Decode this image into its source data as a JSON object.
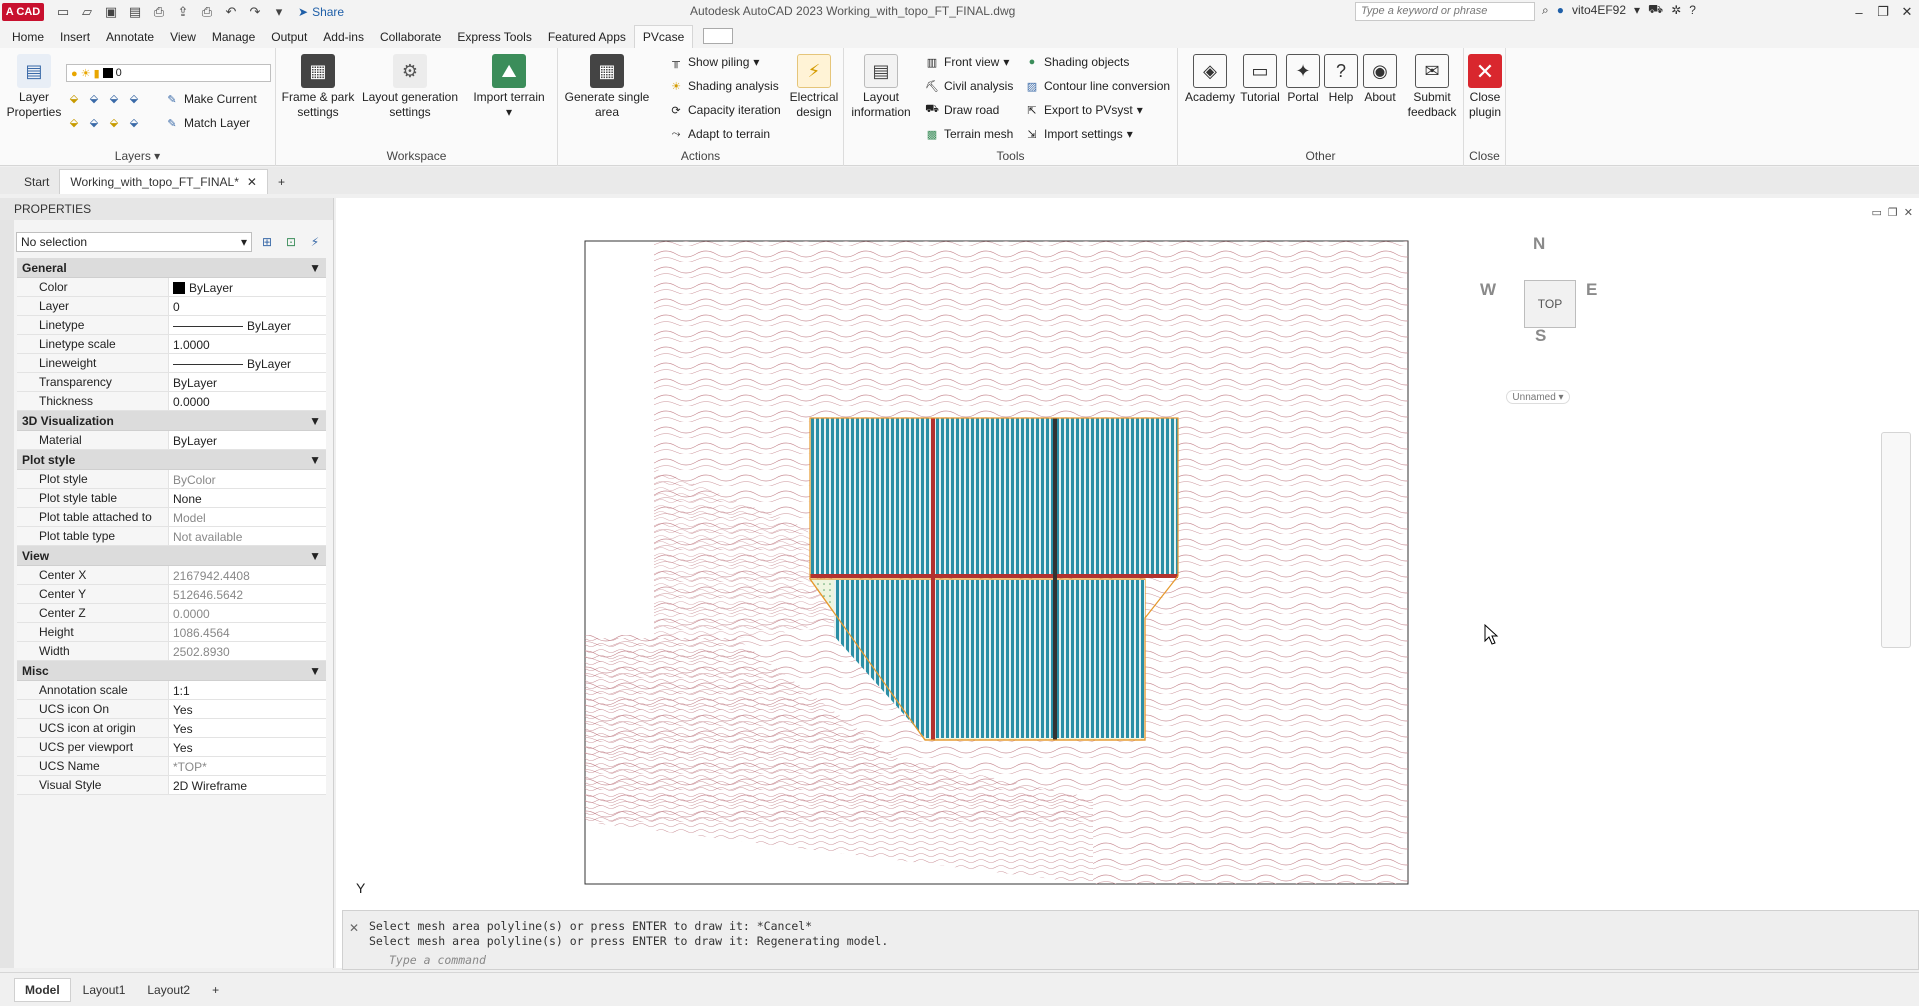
{
  "titlebar": {
    "logo": "A CAD",
    "share": "Share",
    "title": "Autodesk AutoCAD 2023   Working_with_topo_FT_FINAL.dwg",
    "search_placeholder": "Type a keyword or phrase",
    "user": "vito4EF92"
  },
  "menu": [
    "Home",
    "Insert",
    "Annotate",
    "View",
    "Manage",
    "Output",
    "Add-ins",
    "Collaborate",
    "Express Tools",
    "Featured Apps",
    "PVcase"
  ],
  "ribbon": {
    "layers": {
      "title": "Layers",
      "layer_properties": "Layer Properties",
      "current_layer": "0",
      "make_current": "Make Current",
      "match_layer": "Match Layer"
    },
    "workspace": {
      "title": "Workspace",
      "frame_park": "Frame & park settings",
      "layout_generation": "Layout generation settings",
      "import_terrain": "Import terrain"
    },
    "actions": {
      "title": "Actions",
      "generate_single_area": "Generate single area",
      "show_piling": "Show piling",
      "shading_analysis": "Shading analysis",
      "capacity_iteration": "Capacity iteration",
      "adapt_to_terrain": "Adapt to terrain",
      "electrical_design": "Electrical design"
    },
    "tools": {
      "title": "Tools",
      "layout_information": "Layout information",
      "front_view": "Front view",
      "civil_analysis": "Civil analysis",
      "draw_road": "Draw road",
      "terrain_mesh": "Terrain mesh",
      "shading_objects": "Shading objects",
      "contour_line_conversion": "Contour line conversion",
      "export_pvsyst": "Export to PVsyst",
      "import_settings": "Import settings"
    },
    "other": {
      "title": "Other",
      "academy": "Academy",
      "tutorial": "Tutorial",
      "portal": "Portal",
      "help": "Help",
      "about": "About",
      "submit_feedback": "Submit feedback"
    },
    "close": {
      "title": "Close",
      "close_plugin": "Close plugin"
    }
  },
  "doctabs": {
    "start": "Start",
    "active": "Working_with_topo_FT_FINAL*"
  },
  "properties": {
    "title": "PROPERTIES",
    "selection": "No selection",
    "general": {
      "title": "General",
      "color_label": "Color",
      "color_value": "ByLayer",
      "layer_label": "Layer",
      "layer_value": "0",
      "linetype_label": "Linetype",
      "linetype_value": "ByLayer",
      "linetype_scale_label": "Linetype scale",
      "linetype_scale_value": "1.0000",
      "lineweight_label": "Lineweight",
      "lineweight_value": "ByLayer",
      "transparency_label": "Transparency",
      "transparency_value": "ByLayer",
      "thickness_label": "Thickness",
      "thickness_value": "0.0000"
    },
    "viz3d": {
      "title": "3D Visualization",
      "material_label": "Material",
      "material_value": "ByLayer"
    },
    "plot": {
      "title": "Plot style",
      "plot_style_label": "Plot style",
      "plot_style_value": "ByColor",
      "plot_style_table_label": "Plot style table",
      "plot_style_table_value": "None",
      "plot_table_attached_label": "Plot table attached to",
      "plot_table_attached_value": "Model",
      "plot_table_type_label": "Plot table type",
      "plot_table_type_value": "Not available"
    },
    "view": {
      "title": "View",
      "center_x_label": "Center X",
      "center_x_value": "2167942.4408",
      "center_y_label": "Center Y",
      "center_y_value": "512646.5642",
      "center_z_label": "Center Z",
      "center_z_value": "0.0000",
      "height_label": "Height",
      "height_value": "1086.4564",
      "width_label": "Width",
      "width_value": "2502.8930"
    },
    "misc": {
      "title": "Misc",
      "annotation_scale_label": "Annotation scale",
      "annotation_scale_value": "1:1",
      "ucs_icon_on_label": "UCS icon On",
      "ucs_icon_on_value": "Yes",
      "ucs_icon_origin_label": "UCS icon at origin",
      "ucs_icon_origin_value": "Yes",
      "ucs_per_viewport_label": "UCS per viewport",
      "ucs_per_viewport_value": "Yes",
      "ucs_name_label": "UCS Name",
      "ucs_name_value": "*TOP*",
      "visual_style_label": "Visual Style",
      "visual_style_value": "2D Wireframe"
    }
  },
  "viewcube": {
    "n": "N",
    "s": "S",
    "e": "E",
    "w": "W",
    "top": "TOP",
    "named": "Unnamed"
  },
  "canvas": {
    "y_axis": "Y"
  },
  "command": {
    "line1": "Select mesh area polyline(s) or press ENTER to draw it: *Cancel*",
    "line2": "Select mesh area polyline(s) or press ENTER to draw it:  Regenerating model.",
    "placeholder": "Type a command"
  },
  "layouts": [
    "Model",
    "Layout1",
    "Layout2"
  ],
  "colors": {
    "contour": "#c98f96",
    "panel_blue": "#2b8fa6",
    "road_red": "#b3322f",
    "boundary_orange": "#e6992e",
    "close_red": "#d9272e"
  }
}
